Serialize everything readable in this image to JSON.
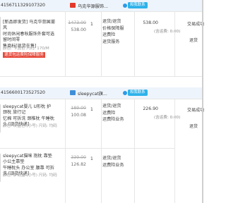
{
  "orders": [
    {
      "order_no": "4156711329107320",
      "shop_name": "乌克华源服饰...",
      "contact_label": "和我联系",
      "item": {
        "title": "[新品即发货] 马克华菲国潮风\n时尚休闲春秋服饰外套可选留时间零\n售商标[现货在售]",
        "sku": "颜色: 卡其色 尺码: 170/M",
        "tag": "退货包运费险保障服务",
        "price_original": "1473.00",
        "price": "538.00",
        "qty": "1",
        "service": "退货/退货\n价格保障服\n运费险\n退货服务"
      },
      "total": "538.00",
      "total_note": "(含运费: 0.00)",
      "status": "交易成功",
      "return_label": "退货",
      "extra": "回"
    },
    {
      "order_no": "4156600173527520",
      "shop_name": "sleepycat旗...",
      "contact_label": "和我联系",
      "items": [
        {
          "title": "sleepycat婴儿 U形枕 护颈枕 旅行记\n忆棉 可拆洗 颈椎枕 午睡枕头 [现货快递]",
          "sku": "颜色: 灰蓝色 (小号) 尺码: 均码",
          "price_original": "189.00",
          "price": "100.08",
          "qty": "1",
          "service": "退货/退货\n运费险\n运费险业务"
        },
        {
          "title": "sleepycat猫咪 抱枕 靠垫 小公主靠垫\n午睡枕头 办公室 腰靠 可拆洗 [现货快递]",
          "sku": "颜色: 梦幻蓝 (小号) 尺码: 均码",
          "price_original": "339.00",
          "price": "126.82",
          "qty": "1",
          "service": "退货/退货\n运费险业务"
        }
      ],
      "total": "226.90",
      "total_note": "(含运费: 0.00)",
      "status": "交易成功",
      "return_label": "退货",
      "extra": "回"
    }
  ]
}
